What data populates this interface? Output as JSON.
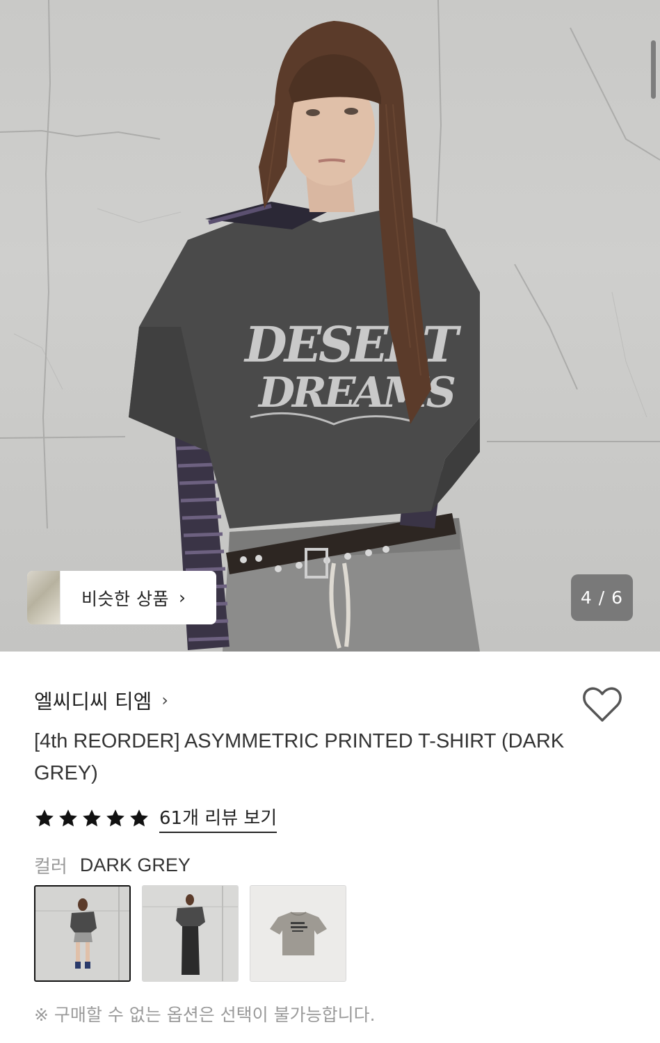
{
  "gallery": {
    "current": 4,
    "total": 6,
    "counter_text": "4 / 6",
    "tshirt_print_line1": "DESERT",
    "tshirt_print_line2": "DREAMS"
  },
  "similar": {
    "label": "비슷한 상품",
    "chevron": "›"
  },
  "product": {
    "brand": "엘씨디씨 티엠",
    "brand_chevron": "›",
    "title": "[4th REORDER] ASYMMETRIC PRINTED T-SHIRT (DARK GREY)",
    "rating_stars": 5,
    "review_link": "61개 리뷰 보기"
  },
  "options": {
    "color_label": "컬러",
    "color_value": "DARK GREY",
    "swatches": [
      "model-front",
      "model-full",
      "flat-lay"
    ],
    "selected_index": 0,
    "notice": "※ 구매할 수 없는 옵션은 선택이 불가능합니다."
  },
  "icons": {
    "heart": "heart-outline-icon",
    "star": "star-filled-icon"
  },
  "colors": {
    "shirt": "#4a4a4a",
    "text_primary": "#222222",
    "text_muted": "#9a9a9a"
  }
}
